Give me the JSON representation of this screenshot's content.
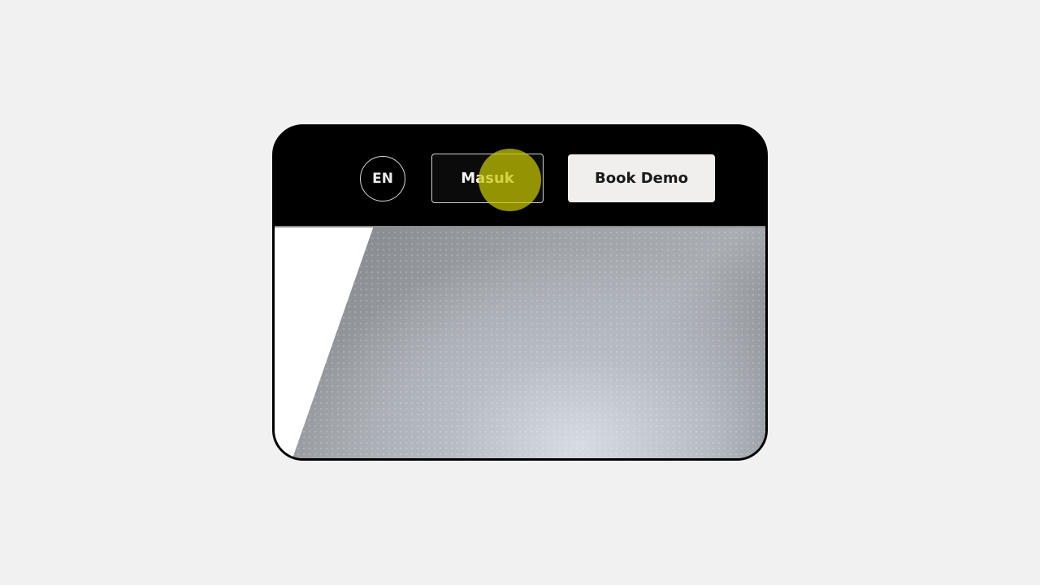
{
  "header": {
    "language_label": "EN",
    "login_label": "Masuk",
    "demo_label": "Book Demo"
  },
  "colors": {
    "page_background": "#f1f1f1",
    "navbar_background": "#000000",
    "demo_button_background": "#f1efee",
    "cursor_highlight": "#c8c800"
  },
  "cursor": {
    "target": "login-button"
  }
}
